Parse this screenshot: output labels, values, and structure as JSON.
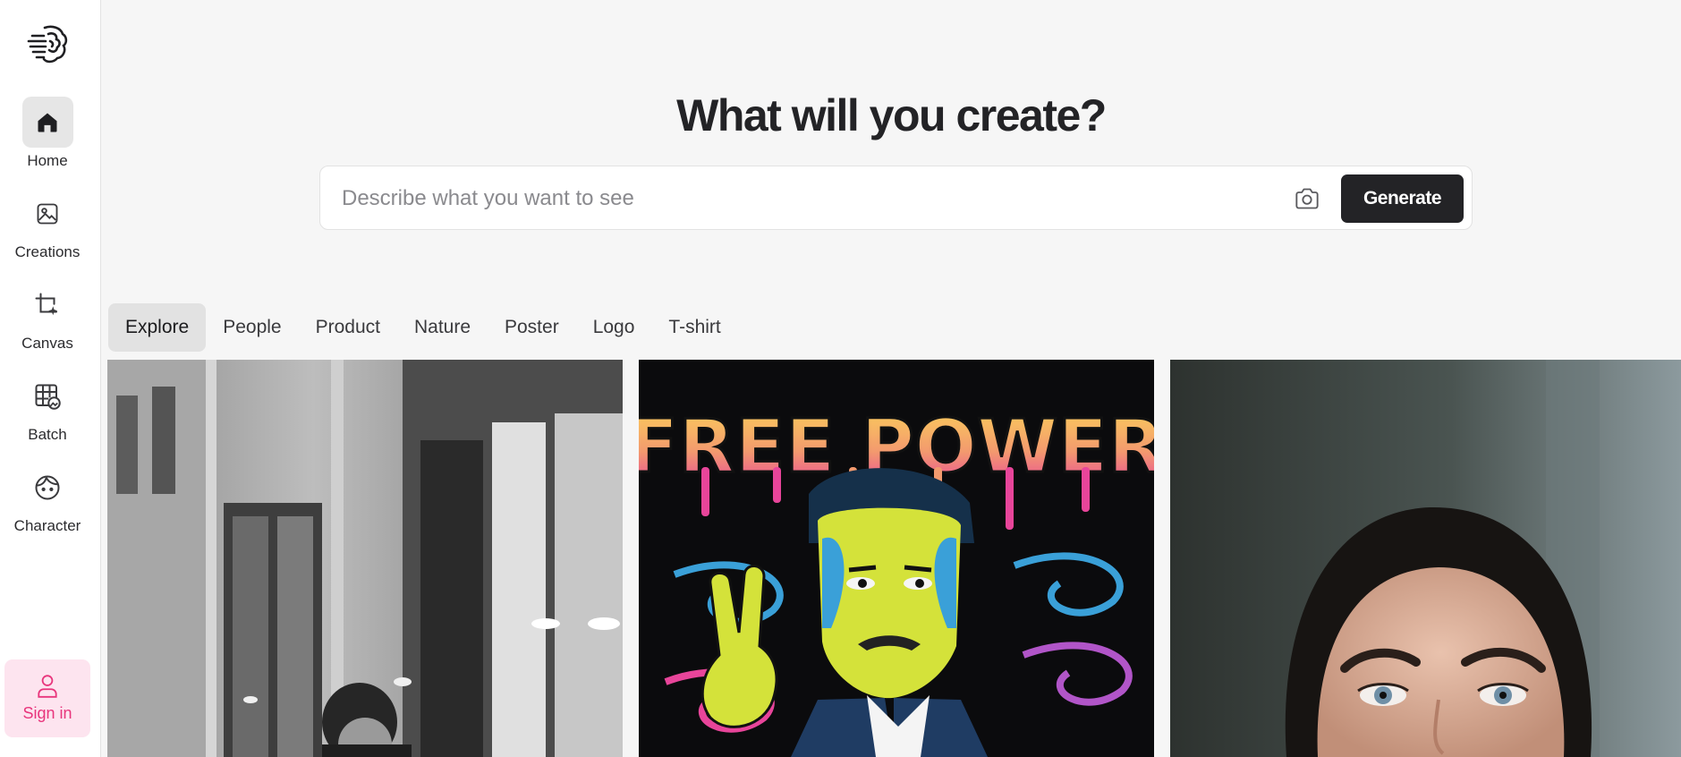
{
  "sidebar": {
    "logo_icon": "brain-lines-icon",
    "items": [
      {
        "label": "Home",
        "icon": "home-icon",
        "active": true
      },
      {
        "label": "Creations",
        "icon": "image-icon"
      },
      {
        "label": "Canvas",
        "icon": "crop-sparkle-icon"
      },
      {
        "label": "Batch",
        "icon": "grid-image-icon"
      },
      {
        "label": "Character",
        "icon": "face-icon"
      }
    ],
    "signin": {
      "label": "Sign in",
      "icon": "user-icon"
    }
  },
  "hero": {
    "title": "What will you create?"
  },
  "prompt": {
    "placeholder": "Describe what you want to see",
    "value": "",
    "camera_icon": "camera-icon",
    "generate_label": "Generate"
  },
  "tabs": [
    {
      "label": "Explore",
      "active": true
    },
    {
      "label": "People"
    },
    {
      "label": "Product"
    },
    {
      "label": "Nature"
    },
    {
      "label": "Poster"
    },
    {
      "label": "Logo"
    },
    {
      "label": "T-shirt"
    }
  ],
  "gallery": {
    "poster_text": "FREE POWER"
  },
  "colors": {
    "accent": "#e8357c",
    "signin_bg": "#fde4ef",
    "button_dark": "#232326",
    "page_bg": "#f6f6f6"
  }
}
